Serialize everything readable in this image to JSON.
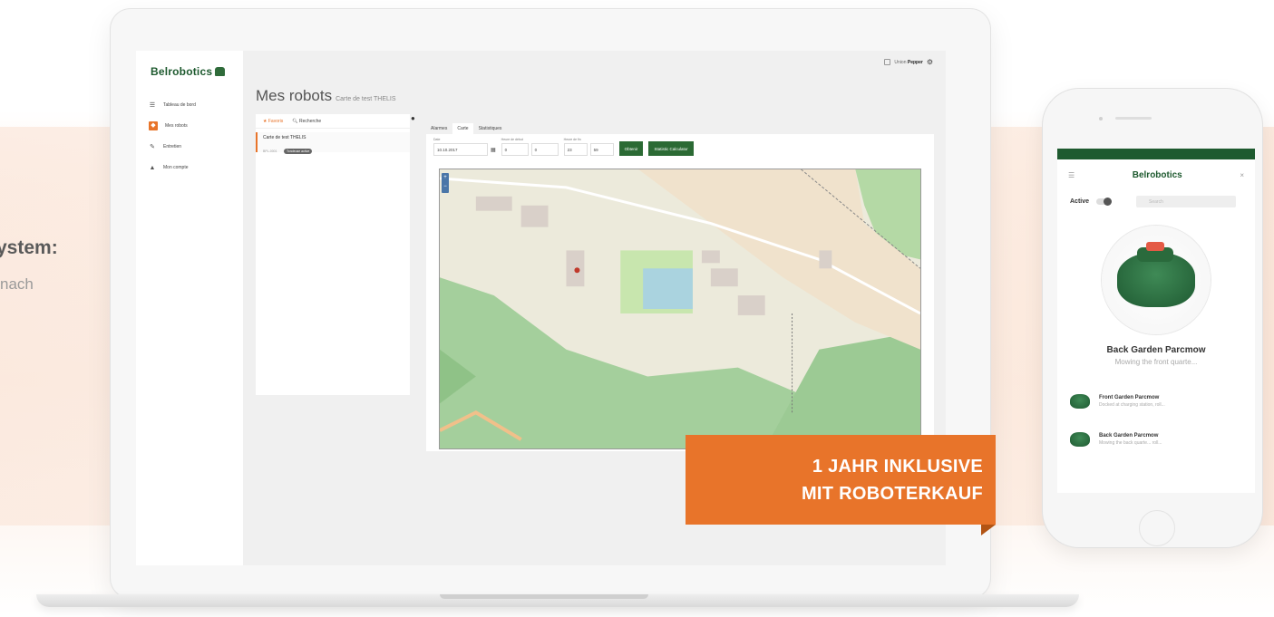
{
  "background_text": {
    "heading_fragment": "ystem:",
    "sub_fragment": "nach"
  },
  "app": {
    "logo": "Belrobotics",
    "sidebar": {
      "items": [
        {
          "icon": "dashboard-icon",
          "label": "Tableau de bord"
        },
        {
          "icon": "robot-icon",
          "label": "Mes robots"
        },
        {
          "icon": "wrench-icon",
          "label": "Entretien"
        },
        {
          "icon": "user-icon",
          "label": "Mon compte"
        }
      ]
    },
    "topbar": {
      "user_prefix": "Union",
      "user_name": "Pepper"
    },
    "page_title": "Mes robots",
    "page_subtitle": "Carte de test THELIS",
    "list_panel": {
      "tabs": [
        "Favoris",
        "Recherche"
      ],
      "row": {
        "name": "Carte de test THELIS",
        "meta": "BPL-0001",
        "badge": "Tondeuse active"
      }
    },
    "detail_tabs": [
      "Alarmes",
      "Carte",
      "Statistiques"
    ],
    "form": {
      "date_label": "Date",
      "date_value": "10.10.2017",
      "start_label": "Heure de début",
      "start_h": "0",
      "start_m": "0",
      "end_label": "Heure de fin",
      "end_h": "23",
      "end_m": "59",
      "btn_primary": "Obtenir",
      "btn_secondary": "Statistic Calculator"
    }
  },
  "promo": {
    "line1": "1 JAHR INKLUSIVE",
    "line2": "MIT ROBOTERKAUF",
    "color": "#e8742a"
  },
  "phone": {
    "logo": "Belrobotics",
    "active_label": "Active",
    "search_placeholder": "Search",
    "current_robot": {
      "name": "Back Garden Parcmow",
      "status": "Mowing the front quarte..."
    },
    "robots": [
      {
        "name": "Front Garden Parcmow",
        "status": "Docked at charging station, roll..."
      },
      {
        "name": "Back Garden Parcmow",
        "status": "Mowing the back quarte... roll..."
      }
    ]
  },
  "colors": {
    "brand_green": "#1e5a2f",
    "accent_orange": "#e8742a"
  }
}
